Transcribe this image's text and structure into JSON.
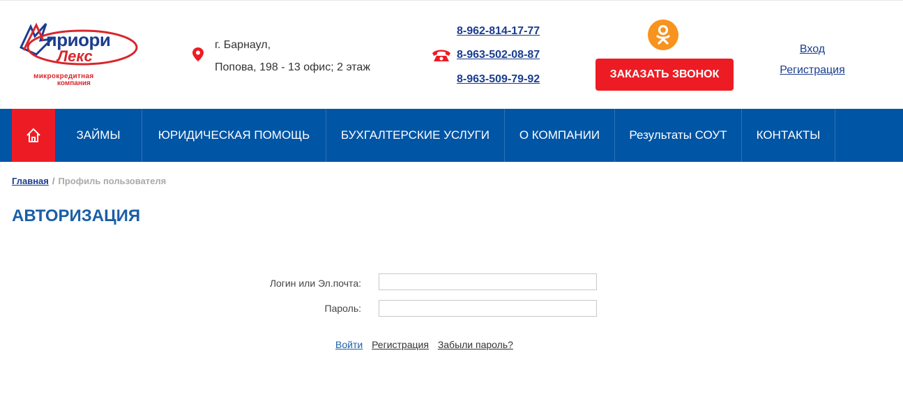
{
  "logo": {
    "word1": "приори",
    "word2": "Лекс",
    "sub1": "микрокредитная",
    "sub2": "компания"
  },
  "address": {
    "line1": "г. Барнаул,",
    "line2": "Попова, 198 - 13 офис; 2 этаж"
  },
  "phones": [
    "8-962-814-17-77",
    "8-963-502-08-87 ",
    "8-963-509-79-92 "
  ],
  "callback_button": "ЗАКАЗАТЬ ЗВОНОК",
  "auth": {
    "login": "Вход",
    "register": "Регистрация"
  },
  "nav": {
    "items": [
      "ЗАЙМЫ",
      "ЮРИДИЧЕСКАЯ ПОМОЩЬ",
      "БУХГАЛТЕРСКИЕ УСЛУГИ",
      "О КОМПАНИИ",
      "Результаты СОУТ",
      "КОНТАКТЫ"
    ]
  },
  "breadcrumb": {
    "home": "Главная",
    "separator": "/",
    "current": "Профиль пользователя"
  },
  "page_title": "АВТОРИЗАЦИЯ",
  "form": {
    "login_label": "Логин или Эл.почта:",
    "login_value": "",
    "password_label": "Пароль:",
    "password_value": "",
    "submit_link": "Войти",
    "register_link": "Регистрация",
    "forgot_link": "Забыли пароль?"
  },
  "colors": {
    "brand_blue": "#0055a5",
    "accent_red": "#ed1c24",
    "link_blue": "#1a3d8f",
    "ok_orange": "#f7931e"
  },
  "icons": [
    "logo-star-icon",
    "map-pin-icon",
    "phone-icon",
    "odnoklassniki-icon",
    "home-icon"
  ]
}
